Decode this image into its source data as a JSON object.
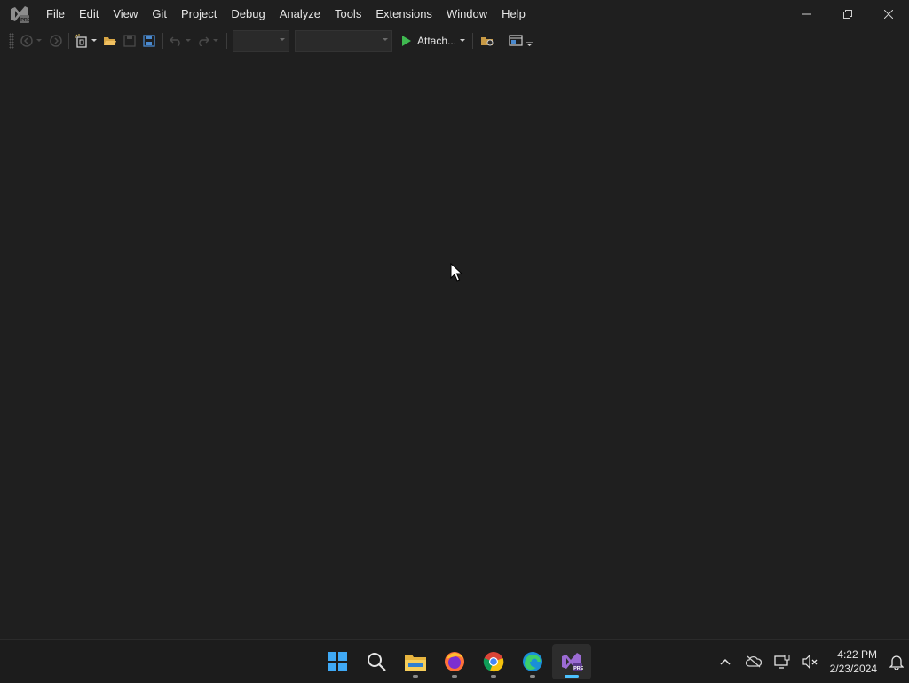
{
  "window": {
    "app_icon": "visual-studio-preview-icon",
    "controls": {
      "minimize": "minimize-icon",
      "restore": "restore-icon",
      "close": "close-icon"
    }
  },
  "menu": {
    "items": [
      "File",
      "Edit",
      "View",
      "Git",
      "Project",
      "Debug",
      "Analyze",
      "Tools",
      "Extensions",
      "Window",
      "Help"
    ]
  },
  "toolbar": {
    "attach_label": "Attach...",
    "solution_config_value": "",
    "solution_platform_value": ""
  },
  "taskbar": {
    "apps": [
      "windows-start-icon",
      "search-icon",
      "file-explorer-icon",
      "firefox-icon",
      "chrome-icon",
      "edge-icon",
      "visual-studio-preview-icon"
    ],
    "clock": {
      "time": "4:22 PM",
      "date": "2/23/2024"
    }
  },
  "colors": {
    "background": "#1f1f1f",
    "taskbar": "#1c1c1c",
    "vs_purple": "#9b6bd3",
    "run_green": "#3fb950",
    "accent_blue": "#4cc2ff"
  }
}
